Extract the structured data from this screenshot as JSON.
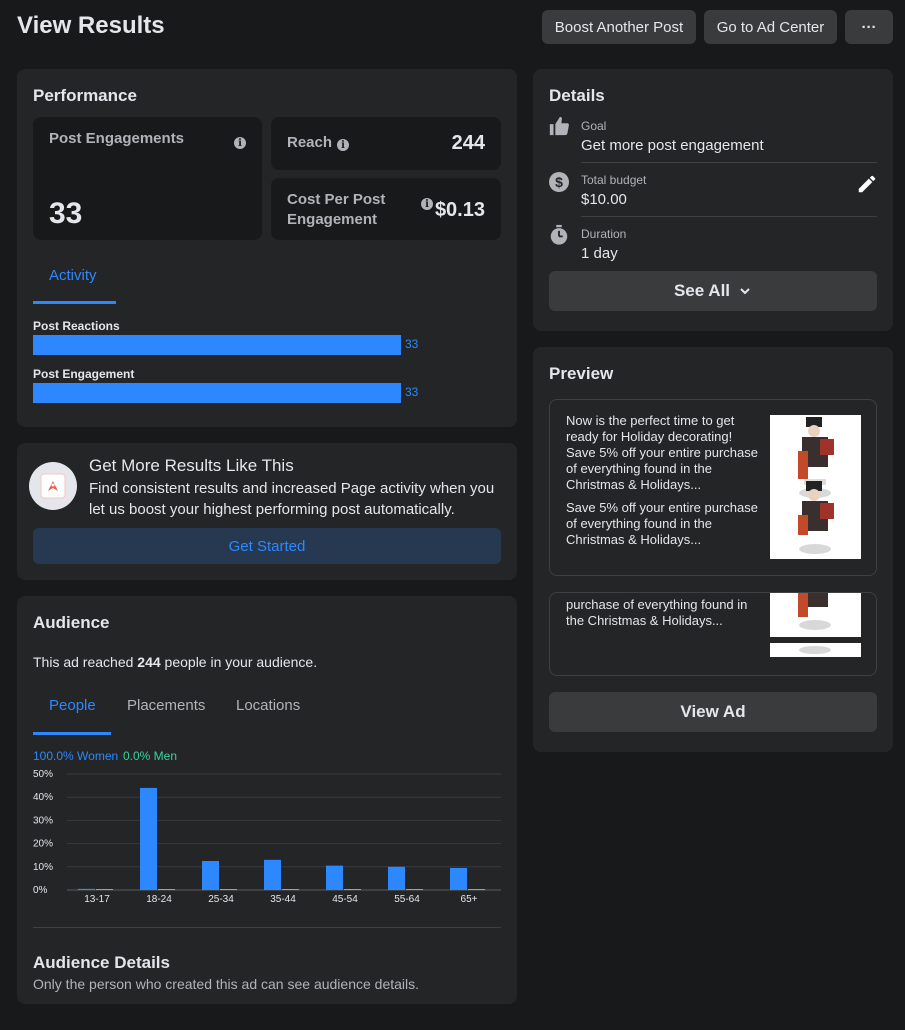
{
  "header": {
    "title": "View Results",
    "boost_label": "Boost Another Post",
    "ad_center_label": "Go to Ad Center",
    "more_label": "···"
  },
  "performance": {
    "title": "Performance",
    "post_engagements_label": "Post Engagements",
    "post_engagements_value": "33",
    "reach_label": "Reach",
    "reach_value": "244",
    "cpe_label_line1": "Cost Per Post",
    "cpe_label_line2": "Engagement",
    "cpe_value": "$0.13",
    "activity_tab": "Activity",
    "bars": [
      {
        "label": "Post Reactions",
        "value": "33",
        "fraction": 1.0
      },
      {
        "label": "Post Engagement",
        "value": "33",
        "fraction": 1.0
      }
    ]
  },
  "promo": {
    "title": "Get More Results Like This",
    "body": "Find consistent results and increased Page activity when you let us boost your highest performing post automatically.",
    "button": "Get Started"
  },
  "audience": {
    "title": "Audience",
    "reached_prefix": "This ad reached ",
    "reached_count": "244",
    "reached_suffix": " people in your audience.",
    "tabs": [
      "People",
      "Placements",
      "Locations"
    ],
    "women_legend": "100.0% Women",
    "men_legend": "0.0% Men",
    "details_title": "Audience Details",
    "details_body": "Only the person who created this ad can see audience details."
  },
  "chart_data": {
    "type": "bar",
    "categories": [
      "13-17",
      "18-24",
      "25-34",
      "35-44",
      "45-54",
      "55-64",
      "65+"
    ],
    "series": [
      {
        "name": "100.0% Women",
        "values": [
          0.5,
          44,
          12.5,
          13,
          10.5,
          10,
          9.5
        ]
      },
      {
        "name": "0.0% Men",
        "values": [
          0.3,
          0.3,
          0.3,
          0.3,
          0.3,
          0.3,
          0.3
        ]
      }
    ],
    "yticks": [
      "50%",
      "40%",
      "30%",
      "20%",
      "10%",
      "0%"
    ],
    "ylim": [
      0,
      50
    ],
    "grid": true,
    "legend": "top-left",
    "colors": {
      "women": "#2d88ff",
      "men": "#3ad29f"
    }
  },
  "details": {
    "title": "Details",
    "goal_label": "Goal",
    "goal_value": "Get more post engagement",
    "budget_label": "Total budget",
    "budget_value": "$10.00",
    "duration_label": "Duration",
    "duration_value": "1 day",
    "see_all": "See All"
  },
  "preview": {
    "title": "Preview",
    "text_block1": "Now is the perfect time to get ready for Holiday decorating! Save 5% off your entire purchase of everything found in the Christmas & Holidays...",
    "text_block2": "Save 5% off your entire purchase of everything found in the Christmas & Holidays...",
    "text_block3": "purchase of everything found in the Christmas & Holidays...",
    "view_ad": "View Ad"
  },
  "colors": {
    "accent": "#2d88ff",
    "background": "#18191a",
    "card": "#242526"
  }
}
